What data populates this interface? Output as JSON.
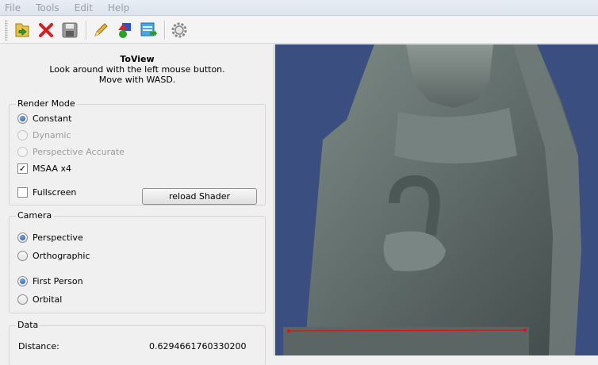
{
  "menu": [
    "File",
    "Tools",
    "Edit",
    "Help"
  ],
  "toolbar": {
    "icons": [
      "open-folder-icon",
      "close-x-icon",
      "save-disk-icon",
      "pencil-icon",
      "shapes-icon",
      "export-window-icon",
      "gear-icon"
    ]
  },
  "panel": {
    "title": "ToView",
    "line1": "Look around with the left mouse button.",
    "line2": "Move with WASD."
  },
  "render_mode": {
    "title": "Render Mode",
    "constant": "Constant",
    "dynamic": "Dynamic",
    "perspective_accurate": "Perspective Accurate",
    "msaa": "MSAA x4",
    "fullscreen": "Fullscreen",
    "reload": "reload Shader"
  },
  "camera": {
    "title": "Camera",
    "perspective": "Perspective",
    "orthographic": "Orthographic",
    "first_person": "First Person",
    "orbital": "Orbital"
  },
  "data_section": {
    "title": "Data",
    "distance_label": "Distance:",
    "distance_value": "0.6294661760330200"
  },
  "colors": {
    "viewport_bg": "#3a4f80",
    "measure_line": "#e01010",
    "radio_selected": "#1e5aa8"
  }
}
